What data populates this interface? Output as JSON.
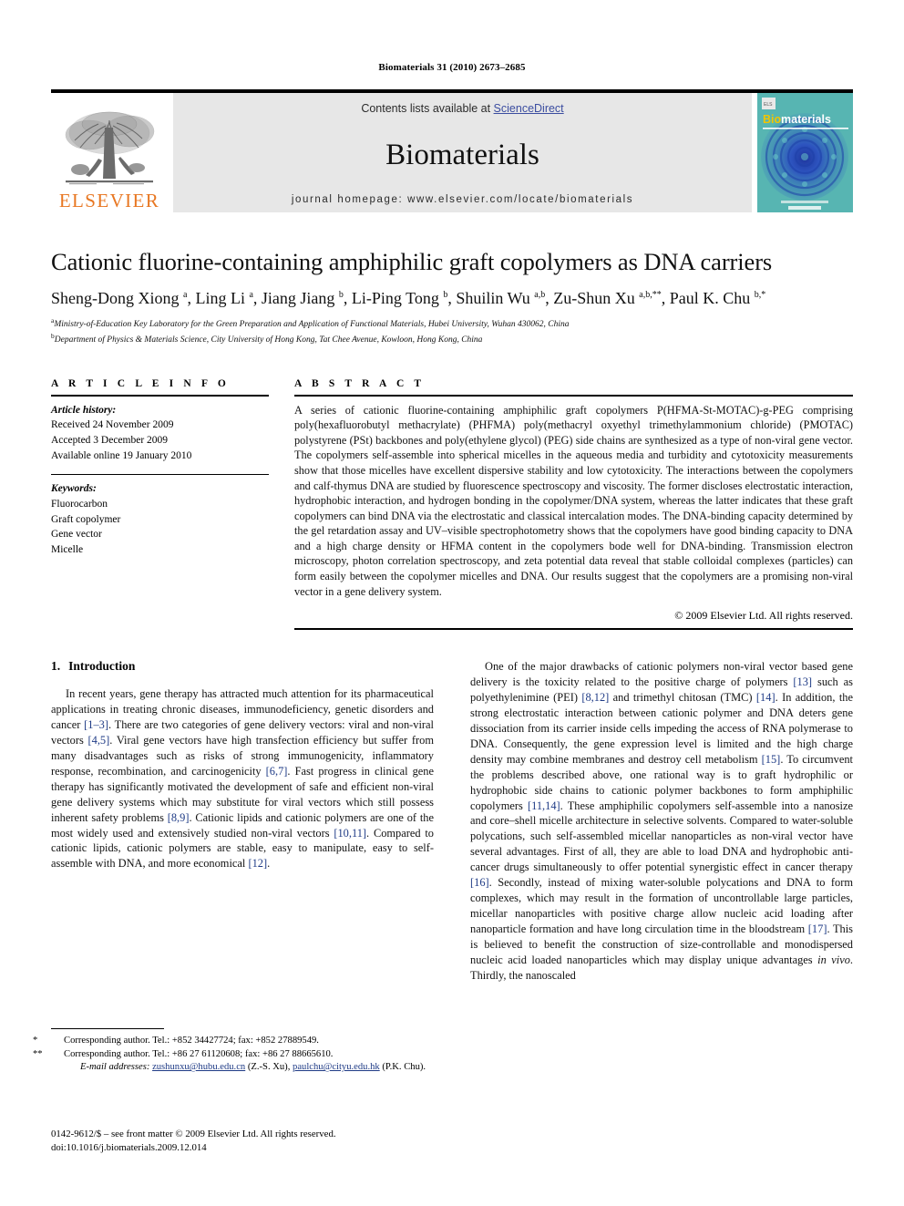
{
  "running_head": "Biomaterials 31 (2010) 2673–2685",
  "masthead": {
    "contents_prefix": "Contents lists available at ",
    "sciencedirect": "ScienceDirect",
    "journal_name": "Biomaterials",
    "homepage": "journal homepage: www.elsevier.com/locate/biomaterials",
    "publisher_wordmark": "ELSEVIER",
    "cover_title": "Biomaterials",
    "accent_orange": "#e87722",
    "accent_link_blue": "#3b4da0",
    "reference_blue": "#1f3b86",
    "masthead_grey": "#e7e7e7"
  },
  "article": {
    "title": "Cationic fluorine-containing amphiphilic graft copolymers as DNA carriers",
    "authors_html": "Sheng-Dong Xiong <sup>a</sup>, Ling Li <sup>a</sup>, Jiang Jiang <sup>b</sup>, Li-Ping Tong <sup>b</sup>, Shuilin Wu <sup>a,b</sup>, Zu-Shun Xu <sup>a,b,**</sup>, Paul K. Chu <sup>b,*</sup>",
    "affiliation_a": "Ministry-of-Education Key Laboratory for the Green Preparation and Application of Functional Materials, Hubei University, Wuhan 430062, China",
    "affiliation_b": "Department of Physics & Materials Science, City University of Hong Kong, Tat Chee Avenue, Kowloon, Hong Kong, China"
  },
  "article_info": {
    "heading": "A R T I C L E  I N F O",
    "history_label": "Article history:",
    "history": [
      "Received 24 November 2009",
      "Accepted 3 December 2009",
      "Available online 19 January 2010"
    ],
    "keywords_label": "Keywords:",
    "keywords": [
      "Fluorocarbon",
      "Graft copolymer",
      "Gene vector",
      "Micelle"
    ]
  },
  "abstract": {
    "heading": "A B S T R A C T",
    "text": "A series of cationic fluorine-containing amphiphilic graft copolymers P(HFMA-St-MOTAC)-g-PEG comprising poly(hexafluorobutyl methacrylate) (PHFMA) poly(methacryl oxyethyl trimethylammonium chloride) (PMOTAC) polystyrene (PSt) backbones and poly(ethylene glycol) (PEG) side chains are synthesized as a type of non-viral gene vector. The copolymers self-assemble into spherical micelles in the aqueous media and turbidity and cytotoxicity measurements show that those micelles have excellent dispersive stability and low cytotoxicity. The interactions between the copolymers and calf-thymus DNA are studied by fluorescence spectroscopy and viscosity. The former discloses electrostatic interaction, hydrophobic interaction, and hydrogen bonding in the copolymer/DNA system, whereas the latter indicates that these graft copolymers can bind DNA via the electrostatic and classical intercalation modes. The DNA-binding capacity determined by the gel retardation assay and UV–visible spectrophotometry shows that the copolymers have good binding capacity to DNA and a high charge density or HFMA content in the copolymers bode well for DNA-binding. Transmission electron microscopy, photon correlation spectroscopy, and zeta potential data reveal that stable colloidal complexes (particles) can form easily between the copolymer micelles and DNA. Our results suggest that the copolymers are a promising non-viral vector in a gene delivery system.",
    "copyright": "© 2009 Elsevier Ltd. All rights reserved."
  },
  "body": {
    "section_number": "1.",
    "section_title": "Introduction",
    "left_paragraph_html": "In recent years, gene therapy has attracted much attention for its pharmaceutical applications in treating chronic diseases, immunodeficiency, genetic disorders and cancer <span class=\"ref\">[1–3]</span>. There are two categories of gene delivery vectors: viral and non-viral vectors <span class=\"ref\">[4,5]</span>. Viral gene vectors have high transfection efficiency but suffer from many disadvantages such as risks of strong immunogenicity, inflammatory response, recombination, and carcinogenicity <span class=\"ref\">[6,7]</span>. Fast progress in clinical gene therapy has significantly motivated the development of safe and efficient non-viral gene delivery systems which may substitute for viral vectors which still possess inherent safety problems <span class=\"ref\">[8,9]</span>. Cationic lipids and cationic polymers are one of the most widely used and extensively studied non-viral vectors <span class=\"ref\">[10,11]</span>. Compared to cationic lipids, cationic polymers are stable, easy to manipulate, easy to self-assemble with DNA, and more economical <span class=\"ref\">[12]</span>.",
    "right_paragraph_html": "One of the major drawbacks of cationic polymers non-viral vector based gene delivery is the toxicity related to the positive charge of polymers <span class=\"ref\">[13]</span> such as polyethylenimine (PEI) <span class=\"ref\">[8,12]</span> and trimethyl chitosan (TMC) <span class=\"ref\">[14]</span>. In addition, the strong electrostatic interaction between cationic polymer and DNA deters gene dissociation from its carrier inside cells impeding the access of RNA polymerase to DNA. Consequently, the gene expression level is limited and the high charge density may combine membranes and destroy cell metabolism <span class=\"ref\">[15]</span>. To circumvent the problems described above, one rational way is to graft hydrophilic or hydrophobic side chains to cationic polymer backbones to form amphiphilic copolymers <span class=\"ref\">[11,14]</span>. These amphiphilic copolymers self-assemble into a nanosize and core–shell micelle architecture in selective solvents. Compared to water-soluble polycations, such self-assembled micellar nanoparticles as non-viral vector have several advantages. First of all, they are able to load DNA and hydrophobic anti-cancer drugs simultaneously to offer potential synergistic effect in cancer therapy <span class=\"ref\">[16]</span>. Secondly, instead of mixing water-soluble polycations and DNA to form complexes, which may result in the formation of uncontrollable large particles, micellar nanoparticles with positive charge allow nucleic acid loading after nanoparticle formation and have long circulation time in the bloodstream <span class=\"ref\">[17]</span>. This is believed to benefit the construction of size-controllable and monodispersed nucleic acid loaded nanoparticles which may display unique advantages <i>in vivo</i>. Thirdly, the nanoscaled"
  },
  "footnotes": {
    "line1_mark": "*",
    "line1": "Corresponding author. Tel.: +852 34427724; fax: +852 27889549.",
    "line2_mark": "**",
    "line2": "Corresponding author. Tel.: +86 27 61120608; fax: +86 27 88665610.",
    "email_label": "E-mail addresses:",
    "email1": "zushunxu@hubu.edu.cn",
    "email1_owner": "(Z.-S. Xu),",
    "email2": "paulchu@cityu.edu.hk",
    "email2_owner": "(P.K. Chu)."
  },
  "imprint": {
    "line1": "0142-9612/$ – see front matter © 2009 Elsevier Ltd. All rights reserved.",
    "line2": "doi:10.1016/j.biomaterials.2009.12.014"
  }
}
